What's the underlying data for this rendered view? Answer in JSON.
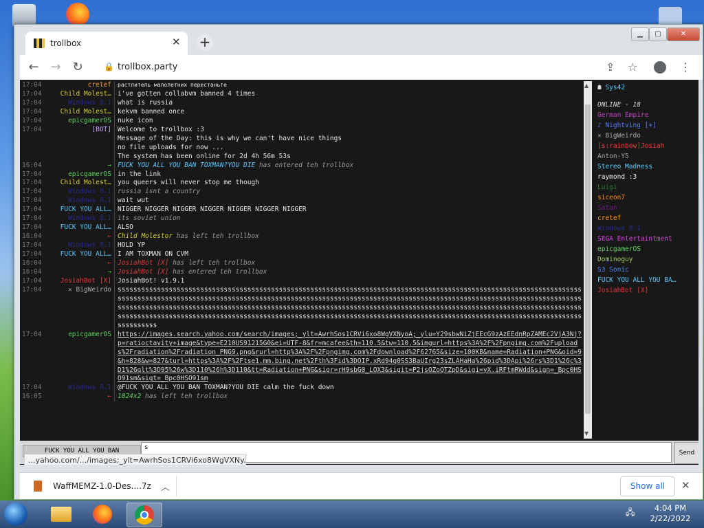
{
  "browser": {
    "tab_title": "trollbox",
    "url": "trollbox.party",
    "new_tab_symbol": "+",
    "tab_close_symbol": "✕"
  },
  "chat": [
    {
      "ts": "17:04",
      "nick": "cretef",
      "nick_color": "#ff9a2e",
      "msg": "растлитель малолетних перестаньте",
      "style": "small"
    },
    {
      "ts": "17:04",
      "nick": "Child Molest…",
      "nick_color": "#d7d035",
      "msg": "i've gotten collabvm banned 4 times"
    },
    {
      "ts": "17:04",
      "nick": "Windows 8.1",
      "nick_color": "#232a8c",
      "msg": "what is russia"
    },
    {
      "ts": "17:04",
      "nick": "Child Molest…",
      "nick_color": "#d7d035",
      "msg": "kekvm banned once"
    },
    {
      "ts": "17:04",
      "nick": "epicgamerOS",
      "nick_color": "#5fd35f",
      "msg": "nuke icon"
    },
    {
      "ts": "17:04",
      "nick": "[BOT]",
      "nick_color": "#c8a0ff",
      "msg": "Welcome to trollbox :3"
    },
    {
      "ts": "",
      "nick": "",
      "nick_color": "#777",
      "msg": " "
    },
    {
      "ts": "",
      "nick": "",
      "nick_color": "#777",
      "msg": "Message of the Day: this is why we can't have nice things"
    },
    {
      "ts": "",
      "nick": "",
      "nick_color": "#777",
      "msg": "no file uploads for now ..."
    },
    {
      "ts": "",
      "nick": "",
      "nick_color": "#777",
      "msg": " "
    },
    {
      "ts": "",
      "nick": "",
      "nick_color": "#777",
      "msg": "The system has been online for 2d 4h 56m 53s"
    },
    {
      "ts": "16:04",
      "nick": "→",
      "nick_color": "#3fcf3f",
      "msg": "FUCK YOU ALL YOU BAN TOXMAN?YOU DIE has entered teh trollbox",
      "style": "italic",
      "em": "FUCK YOU ALL YOU BAN TOXMAN?YOU DIE",
      "em_color": "#5ac8ff"
    },
    {
      "ts": "17:04",
      "nick": "epicgamerOS",
      "nick_color": "#5fd35f",
      "msg": "in the link"
    },
    {
      "ts": "17:04",
      "nick": "Child Molest…",
      "nick_color": "#d7d035",
      "msg": "you queers will never stop me though"
    },
    {
      "ts": "17:04",
      "nick": "Windows 8.1",
      "nick_color": "#232a8c",
      "msg": "russia isnt a country",
      "style": "italic"
    },
    {
      "ts": "17:04",
      "nick": "Windows 8.1",
      "nick_color": "#232a8c",
      "msg": "wait wut"
    },
    {
      "ts": "17:04",
      "nick": "FUCK YOU ALL…",
      "nick_color": "#5ac8ff",
      "msg": "NIGGER NIGGER NIGGER NIGGER NIGGER NIGGER NIGGER"
    },
    {
      "ts": "17:04",
      "nick": "Windows 8.1",
      "nick_color": "#232a8c",
      "msg": "its soviet union",
      "style": "italic"
    },
    {
      "ts": "17:04",
      "nick": "FUCK YOU ALL…",
      "nick_color": "#5ac8ff",
      "msg": "ALSO"
    },
    {
      "ts": "16:04",
      "nick": "←",
      "nick_color": "#e03a3a",
      "msg": "Child Molestor has left teh trollbox",
      "style": "italic",
      "em": "Child Molestor",
      "em_color": "#d7d035"
    },
    {
      "ts": "17:04",
      "nick": "Windows 8.1",
      "nick_color": "#232a8c",
      "msg": "HOLD YP"
    },
    {
      "ts": "17:04",
      "nick": "FUCK YOU ALL…",
      "nick_color": "#5ac8ff",
      "msg": "I AM TOXMAN ON CVM"
    },
    {
      "ts": "16:04",
      "nick": "←",
      "nick_color": "#e03a3a",
      "msg": "JosiahBot [X] has left teh trollbox",
      "style": "italic",
      "em": "JosiahBot [X]",
      "em_color": "#e03a3a"
    },
    {
      "ts": "16:04",
      "nick": "→",
      "nick_color": "#3fcf3f",
      "msg": "JosiahBot [X] has entered teh trollbox",
      "style": "italic",
      "em": "JosiahBot [X]",
      "em_color": "#e03a3a"
    },
    {
      "ts": "17:04",
      "nick": "JosiahBot [X]",
      "nick_color": "#e03a3a",
      "msg": "JosiahBot! v1.9.1"
    },
    {
      "ts": "17:04",
      "nick": "✕ BigWeirdo",
      "nick_color": "#aaaaaa",
      "msg": "ssssssssssssssssssssssssssssssssssssssssssssssssssssssssssssssssssssssssssssssssssssssssssssssssssssssssssssssssssssssssssssssssssssssssssssssssssssssssssssssssssssssssssssssssssssssssssssssssssssssssssssssssssssssssssssssssssssssssssssssssssssssssssssssssssssssssssssssssssssssssssssssssssssssssssssssssssssssssssssssssssssssssssssssssssssssssssssssssssssssssssssssssssssssssssssssssssssssssssssssssssssssssssssssssssssssssssssssssssssssssssssssssssssssssssssssssssssssssssssssssss",
      "style": "sss"
    },
    {
      "ts": "17:04",
      "nick": "epicgamerOS",
      "nick_color": "#5fd35f",
      "msg": "https://images.search.yahoo.com/search/images;_ylt=AwrhSos1CRVi6xo8WgVXNyoA;_ylu=Y29sbwNiZjEEcG9zAzEEdnRpZAMEc2VjA3Nj?p=ratioctavity+image&type=E210US91215G0&ei=UTF-8&fr=mcafee&th=110.5&tw=110.5&imgurl=https%3A%2F%2Fpngimg.com%2Fuploads%2Fradiation%2Fradiation_PNG9.png&rurl=http%3A%2F%2Fpngimg.com%2Fdownload%2F62765&size=100KB&name=Radiation+PNG&oid=9&h=828&w=827&turl=https%3A%2F%2Ftse1.mm.bing.net%2Fth%3Fid%3DOIP.xRd94q0SS3BaUIrg23sZLAHaHa%26pid%3DApi%26rs%3D1%26c%3D1%26qlt%3D95%26w%3D110%26h%3D110&tt=Radiation+PNG&sigr=rH9sbG0_LOX3&sigit=P2jsOZoQTZpD&sigi=yX.iRFtmRWdd&sign=_Bpc0HSO91sm&sigt=_Bpc0HSO91sm",
      "style": "link"
    },
    {
      "ts": "17:04",
      "nick": "Windows 8.1",
      "nick_color": "#232a8c",
      "msg": "@FUCK YOU ALL YOU BAN TOXMAN?YOU DIE calm the fuck down"
    },
    {
      "ts": "16:05",
      "nick": "←",
      "nick_color": "#e03a3a",
      "msg": "1024x2 has left teh trollbox",
      "style": "italic",
      "em": "1024x2",
      "em_color": "#5fd35f"
    }
  ],
  "users": {
    "me": "Sys42",
    "online_label": "ONLINE - 18",
    "list": [
      {
        "name": "German Empire",
        "color": "#c040c0"
      },
      {
        "name": "♪ Nightving [+]",
        "color": "#5a7cff"
      },
      {
        "name": "✕ BigWeirdo",
        "color": "#aaaaaa"
      },
      {
        "name": "[s:rainbow]Josiah",
        "color": "#ff3a3a"
      },
      {
        "name": "Anton-Y5",
        "color": "#aaaaaa"
      },
      {
        "name": "Stereo Madness",
        "color": "#5ad0ff"
      },
      {
        "name": "raymond :3",
        "color": "#eeeeee"
      },
      {
        "name": "Luigi",
        "color": "#2a7a2a"
      },
      {
        "name": "siceon7",
        "color": "#ff8c1a"
      },
      {
        "name": "Satan",
        "color": "#6a1a8a"
      },
      {
        "name": "cretef",
        "color": "#ff9a2e"
      },
      {
        "name": "Windows 8.1",
        "color": "#232a8c"
      },
      {
        "name": "SEGA Entertaintment",
        "color": "#e040e0"
      },
      {
        "name": "epicgamerOS",
        "color": "#5fd35f"
      },
      {
        "name": "Dominoguy",
        "color": "#a0d060"
      },
      {
        "name": "S3 Sonic",
        "color": "#4a8aff"
      },
      {
        "name": "FUCK YOU ALL YOU BA…",
        "color": "#5ac8ff"
      },
      {
        "name": "JosiahBot [X]",
        "color": "#e03a3a"
      }
    ]
  },
  "input": {
    "nick_value": "FUCK YOU ALL YOU BAN",
    "message_value": "s",
    "send_label": "Send"
  },
  "status_url": "...yahoo.com/.../images;_ylt=AwrhSos1CRVi6xo8WgVXNy...",
  "downloads": {
    "file": "WaffMEMZ-1.0-Des....7z",
    "show_all": "Show all"
  },
  "taskbar": {
    "time": "4:04 PM",
    "date": "2/22/2022"
  }
}
